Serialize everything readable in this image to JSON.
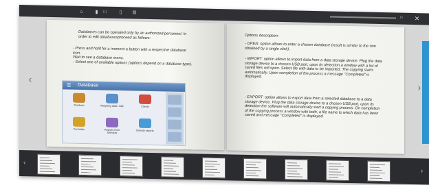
{
  "toolbar": {
    "icons": [
      "home-icon",
      "single-page-icon",
      "double-page-icon",
      "grid-icon",
      "settings-icon",
      "close-icon"
    ],
    "page_indicator": "1/1",
    "zoom_value": "1x"
  },
  "left_page": {
    "intro": "Databases can be operated only by an authorized personnel. In order to edit databasesproceed as follows:",
    "step1": "- Press and hold for a moment a button with a respective database icon.",
    "step2": "Wait to see a database menu.",
    "step3": "- Select one of available options (options depend on a database type)."
  },
  "database_panel": {
    "title": "Database",
    "items": [
      {
        "label": "Products",
        "color": "#c98a2c"
      },
      {
        "label": "Weighing data / ABc",
        "color": "#5a8fc8"
      },
      {
        "label": "Clients",
        "color": "#d14b3f"
      },
      {
        "label": "Formulas",
        "color": "#d6a12a"
      },
      {
        "label": "Reports from formulas",
        "color": "#8c6bbf"
      },
      {
        "label": "Density reports",
        "color": "#4a9bd3"
      }
    ]
  },
  "right_page": {
    "heading": "Options description:",
    "open": "- OPEN: option allows to enter a chosen database (result is similar to the one obtained by a single click),",
    "import": "- IMPORT: option allows to import data from a data storage device. Plug the data storage device to a chosen USB port, upon its detection a window with a list of saved files will open. Select file with data to be imported. The copying starts automatically. Upon completion of the process a message \"Completed\" is displayed.",
    "export": "- EXPORT: option allows to export data from a selected database to a data storage device. Plug the data storage device to a chosen USB port, upon its detection the software will automatically start a copying process. On completion of the copying process a window with both, a file name to which data has been saved and message \"Completed\" is displayed."
  },
  "navigation": {
    "prev": "‹",
    "next": "›"
  },
  "thumbnails": {
    "count": 9,
    "prev": "‹",
    "next": "›"
  },
  "colors": {
    "toolbar": "#2f3033",
    "viewer": "#d6d6d6",
    "strip": "#2b2c2f",
    "accent": "#2f93cf"
  }
}
